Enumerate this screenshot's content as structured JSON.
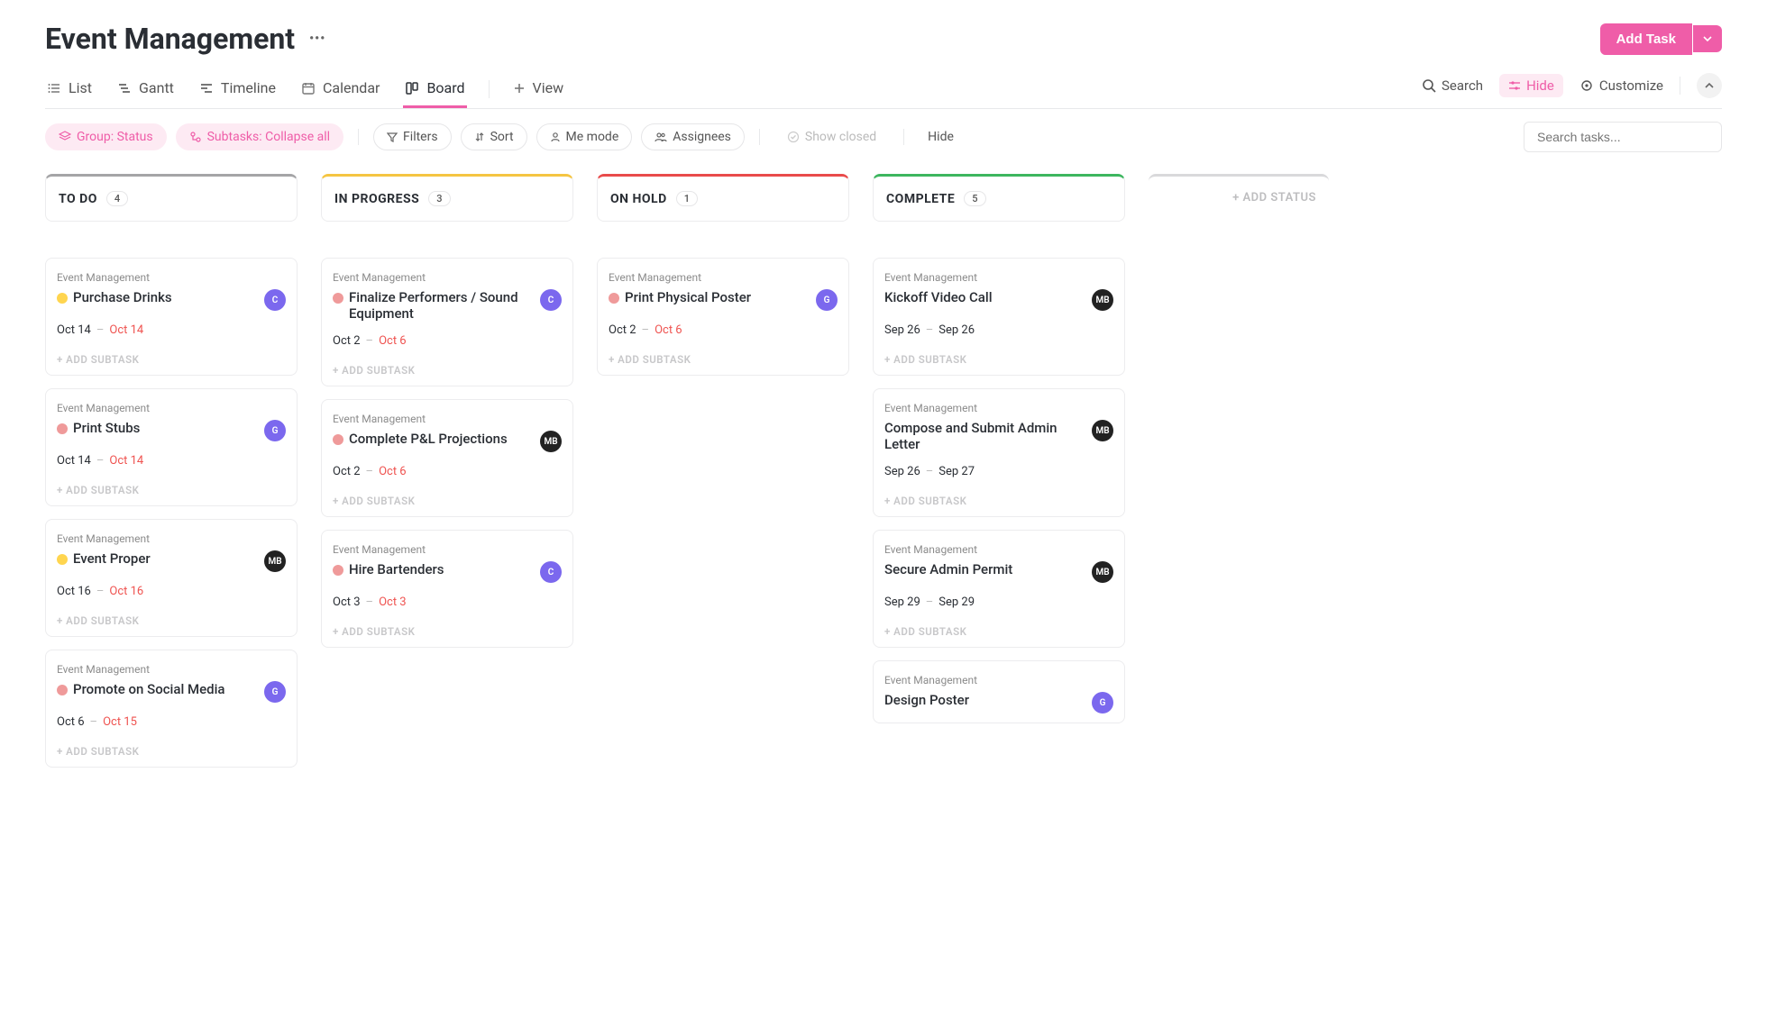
{
  "header": {
    "title": "Event Management",
    "add_task_label": "Add Task"
  },
  "views": {
    "tabs": [
      {
        "label": "List",
        "active": false
      },
      {
        "label": "Gantt",
        "active": false
      },
      {
        "label": "Timeline",
        "active": false
      },
      {
        "label": "Calendar",
        "active": false
      },
      {
        "label": "Board",
        "active": true
      }
    ],
    "add_view_label": "View",
    "right": {
      "search": "Search",
      "hide": "Hide",
      "customize": "Customize"
    }
  },
  "filters": {
    "group": "Group: Status",
    "subtasks": "Subtasks: Collapse all",
    "filters": "Filters",
    "sort": "Sort",
    "me_mode": "Me mode",
    "assignees": "Assignees",
    "show_closed": "Show closed",
    "hide": "Hide",
    "search_placeholder": "Search tasks..."
  },
  "board": {
    "add_subtask_label": "+ ADD SUBTASK",
    "add_status_label": "+ ADD STATUS",
    "columns": [
      {
        "title": "TO DO",
        "count": "4",
        "top_color": "#a5a5a7",
        "cards": [
          {
            "project": "Event Management",
            "title": "Purchase Drinks",
            "priority_color": "#ffd54f",
            "avatar_text": "C",
            "avatar_bg": "#7b68ee",
            "start": "Oct 14",
            "end": "Oct 14",
            "end_overdue": true
          },
          {
            "project": "Event Management",
            "title": "Print Stubs",
            "priority_color": "#ef9a9a",
            "avatar_text": "G",
            "avatar_bg": "#7b68ee",
            "start": "Oct 14",
            "end": "Oct 14",
            "end_overdue": true
          },
          {
            "project": "Event Management",
            "title": "Event Proper",
            "priority_color": "#ffd54f",
            "avatar_text": "MB",
            "avatar_bg": "#222",
            "start": "Oct 16",
            "end": "Oct 16",
            "end_overdue": true
          },
          {
            "project": "Event Management",
            "title": "Promote on Social Media",
            "priority_color": "#ef9a9a",
            "avatar_text": "G",
            "avatar_bg": "#7b68ee",
            "start": "Oct 6",
            "end": "Oct 15",
            "end_overdue": true
          }
        ]
      },
      {
        "title": "IN PROGRESS",
        "count": "3",
        "top_color": "#f5c542",
        "cards": [
          {
            "project": "Event Management",
            "title": "Finalize Performers / Sound Equipment",
            "priority_color": "#ef9a9a",
            "avatar_text": "C",
            "avatar_bg": "#7b68ee",
            "start": "Oct 2",
            "end": "Oct 6",
            "end_overdue": true
          },
          {
            "project": "Event Management",
            "title": "Complete P&L Projections",
            "priority_color": "#ef9a9a",
            "avatar_text": "MB",
            "avatar_bg": "#222",
            "start": "Oct 2",
            "end": "Oct 6",
            "end_overdue": true
          },
          {
            "project": "Event Management",
            "title": "Hire Bartenders",
            "priority_color": "#ef9a9a",
            "avatar_text": "C",
            "avatar_bg": "#7b68ee",
            "start": "Oct 3",
            "end": "Oct 3",
            "end_overdue": true
          }
        ]
      },
      {
        "title": "ON HOLD",
        "count": "1",
        "top_color": "#e94b4b",
        "cards": [
          {
            "project": "Event Management",
            "title": "Print Physical Poster",
            "priority_color": "#ef9a9a",
            "avatar_text": "G",
            "avatar_bg": "#7b68ee",
            "start": "Oct 2",
            "end": "Oct 6",
            "end_overdue": true
          }
        ]
      },
      {
        "title": "COMPLETE",
        "count": "5",
        "top_color": "#3db65f",
        "cards": [
          {
            "project": "Event Management",
            "title": "Kickoff Video Call",
            "priority_color": null,
            "avatar_text": "MB",
            "avatar_bg": "#222",
            "start": "Sep 26",
            "end": "Sep 26",
            "end_overdue": false
          },
          {
            "project": "Event Management",
            "title": "Compose and Submit Admin Letter",
            "priority_color": null,
            "avatar_text": "MB",
            "avatar_bg": "#222",
            "start": "Sep 26",
            "end": "Sep 27",
            "end_overdue": false
          },
          {
            "project": "Event Management",
            "title": "Secure Admin Permit",
            "priority_color": null,
            "avatar_text": "MB",
            "avatar_bg": "#222",
            "start": "Sep 29",
            "end": "Sep 29",
            "end_overdue": false
          },
          {
            "project": "Event Management",
            "title": "Design Poster",
            "priority_color": null,
            "avatar_text": "G",
            "avatar_bg": "#7b68ee",
            "start": "",
            "end": "",
            "end_overdue": false
          }
        ]
      }
    ]
  }
}
